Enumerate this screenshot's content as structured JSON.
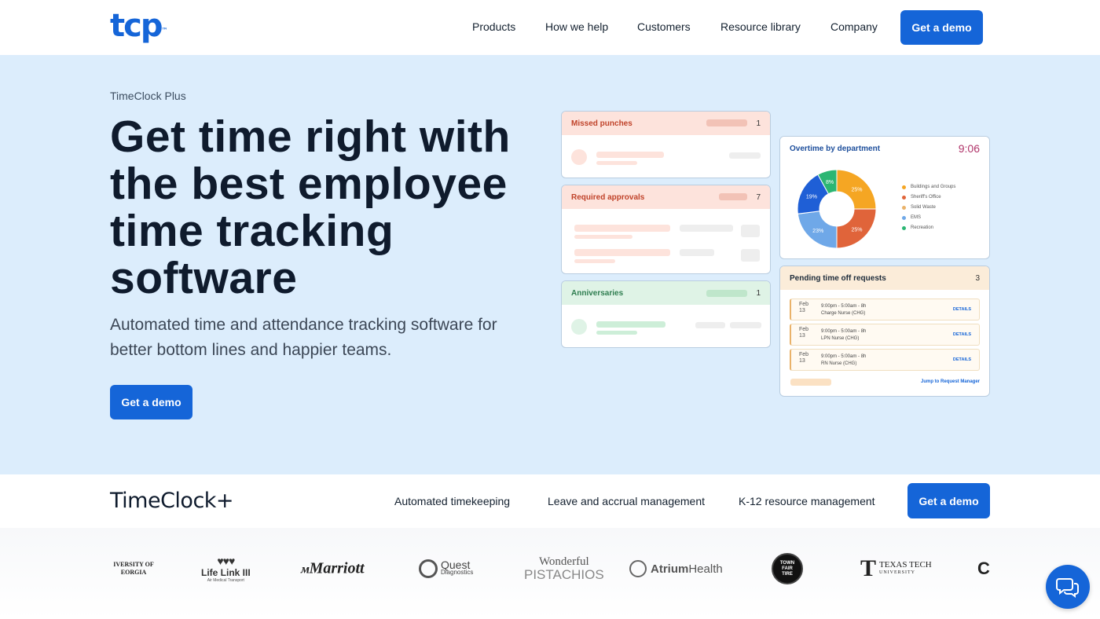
{
  "nav": {
    "logo": "tcp",
    "logo_tm": "™",
    "links": [
      "Products",
      "How we help",
      "Customers",
      "Resource library",
      "Company"
    ],
    "cta": "Get a demo"
  },
  "hero": {
    "eyebrow": "TimeClock Plus",
    "headline": "Get time right with the best employee time tracking software",
    "subtitle": "Automated time and attendance tracking software for better bottom lines and happier teams.",
    "cta": "Get a demo"
  },
  "widgets": {
    "missed": {
      "title": "Missed punches",
      "count": "1"
    },
    "approvals": {
      "title": "Required approvals",
      "count": "7"
    },
    "anniversaries": {
      "title": "Anniversaries",
      "count": "1"
    },
    "overtime": {
      "title": "Overtime by department",
      "time": "9:06",
      "slices": [
        {
          "label": "Buildings and Groups",
          "value": 25,
          "color": "#f5a623"
        },
        {
          "label": "Sheriff's Office",
          "value": 25,
          "color": "#e0643a"
        },
        {
          "label": "Solid Waste",
          "value": 23,
          "color": "#6fa8e8"
        },
        {
          "label": "EMS",
          "value": 19,
          "color": "#1f5fd6"
        },
        {
          "label": "Recreation",
          "value": 8,
          "color": "#2bb673"
        }
      ],
      "slice_labels": [
        "25%",
        "25%",
        "23%",
        "19%",
        "8%"
      ],
      "legend": [
        "Buildings and Groups",
        "Sheriff's Office",
        "Solid Waste",
        "EMS",
        "Recreation"
      ]
    },
    "timeoff": {
      "title": "Pending time off requests",
      "count": "3",
      "rows": [
        {
          "month": "Feb",
          "day": "13",
          "time": "9:00pm - 5:00am - 8h",
          "role": "Charge Nurse (CHG)",
          "action": "DETAILS"
        },
        {
          "month": "Feb",
          "day": "13",
          "time": "9:00pm - 5:00am - 8h",
          "role": "LPN Nurse (CHG)",
          "action": "DETAILS"
        },
        {
          "month": "Feb",
          "day": "13",
          "time": "9:00pm - 5:00am - 8h",
          "role": "RN Nurse (CHG)",
          "action": "DETAILS"
        }
      ],
      "footer_link": "Jump to Request Manager"
    }
  },
  "subnav": {
    "logo": "TimeClock+",
    "links": [
      "Automated timekeeping",
      "Leave and accrual management",
      "K-12 resource management"
    ],
    "cta": "Get a demo"
  },
  "customers": {
    "uga": "IVERSITY OF EORGIA",
    "lifelink": "Life Link III",
    "lifelink_sub": "Air Medical Transport",
    "marriott": "Marriott",
    "quest": "Quest",
    "quest_sub": "Diagnostics",
    "wonderful1": "Wonderful",
    "wonderful2": "PISTACHIOS",
    "atrium1": "Atrium",
    "atrium2": "Health",
    "townfair": "TOWN FAIR TIRE",
    "ttu1": "TEXAS TECH",
    "ttu2": "UNIVERSITY",
    "partial": "C"
  }
}
